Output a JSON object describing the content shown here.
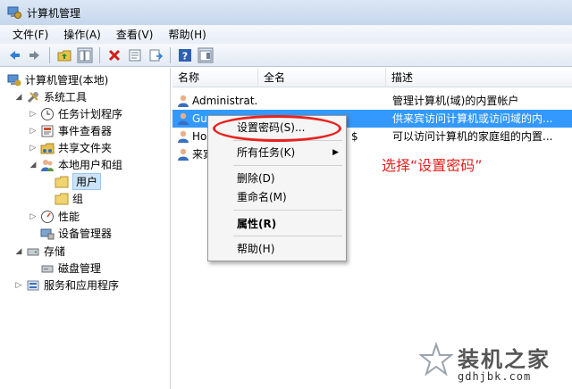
{
  "window": {
    "title": "计算机管理"
  },
  "menu": [
    "文件(F)",
    "操作(A)",
    "查看(V)",
    "帮助(H)"
  ],
  "toolbar": {
    "icons": [
      "back-icon",
      "forward-icon",
      "up-folder-icon",
      "show-hide-tree-icon",
      "delete-icon",
      "properties-icon",
      "export-icon",
      "help-icon",
      "console-icon"
    ]
  },
  "tree": {
    "items": [
      {
        "label": "计算机管理(本地)",
        "icon": "computer-icon",
        "expander": ""
      },
      {
        "label": "系统工具",
        "icon": "tools-icon",
        "expander": "◢"
      },
      {
        "label": "任务计划程序",
        "icon": "clock-icon",
        "expander": "▷"
      },
      {
        "label": "事件查看器",
        "icon": "event-viewer-icon",
        "expander": "▷"
      },
      {
        "label": "共享文件夹",
        "icon": "shared-folder-icon",
        "expander": "▷"
      },
      {
        "label": "本地用户和组",
        "icon": "users-icon",
        "expander": "◢"
      },
      {
        "label": "用户",
        "icon": "folder-icon",
        "expander": ""
      },
      {
        "label": "组",
        "icon": "folder-icon",
        "expander": ""
      },
      {
        "label": "性能",
        "icon": "performance-icon",
        "expander": "▷"
      },
      {
        "label": "设备管理器",
        "icon": "device-manager-icon",
        "expander": ""
      },
      {
        "label": "存储",
        "icon": "storage-icon",
        "expander": "◢"
      },
      {
        "label": "磁盘管理",
        "icon": "disk-icon",
        "expander": ""
      },
      {
        "label": "服务和应用程序",
        "icon": "services-icon",
        "expander": "▷"
      }
    ]
  },
  "list": {
    "columns": [
      "名称",
      "全名",
      "描述"
    ],
    "rows": [
      {
        "name": "Administrat...",
        "fullname": "",
        "desc": "管理计算机(域)的内置帐户"
      },
      {
        "name": "Gue",
        "fullname": "",
        "desc": "供来宾访问计算机或访问域的内..."
      },
      {
        "name": "Ho",
        "fullname": "$",
        "desc": "可以访问计算机的家庭组的内置..."
      },
      {
        "name": "来宾",
        "fullname": "",
        "desc": ""
      }
    ]
  },
  "context_menu": {
    "items": [
      "设置密码(S)...",
      "所有任务(K)",
      "删除(D)",
      "重命名(M)",
      "属性(R)",
      "帮助(H)"
    ],
    "submenu_arrow": "▶"
  },
  "annotation": "选择“设置密码”",
  "watermark": {
    "title": "装机之家",
    "url": "gdhjbk.com"
  },
  "colors": {
    "highlight_red": "#e8221e",
    "selection_blue": "#3399ff"
  }
}
